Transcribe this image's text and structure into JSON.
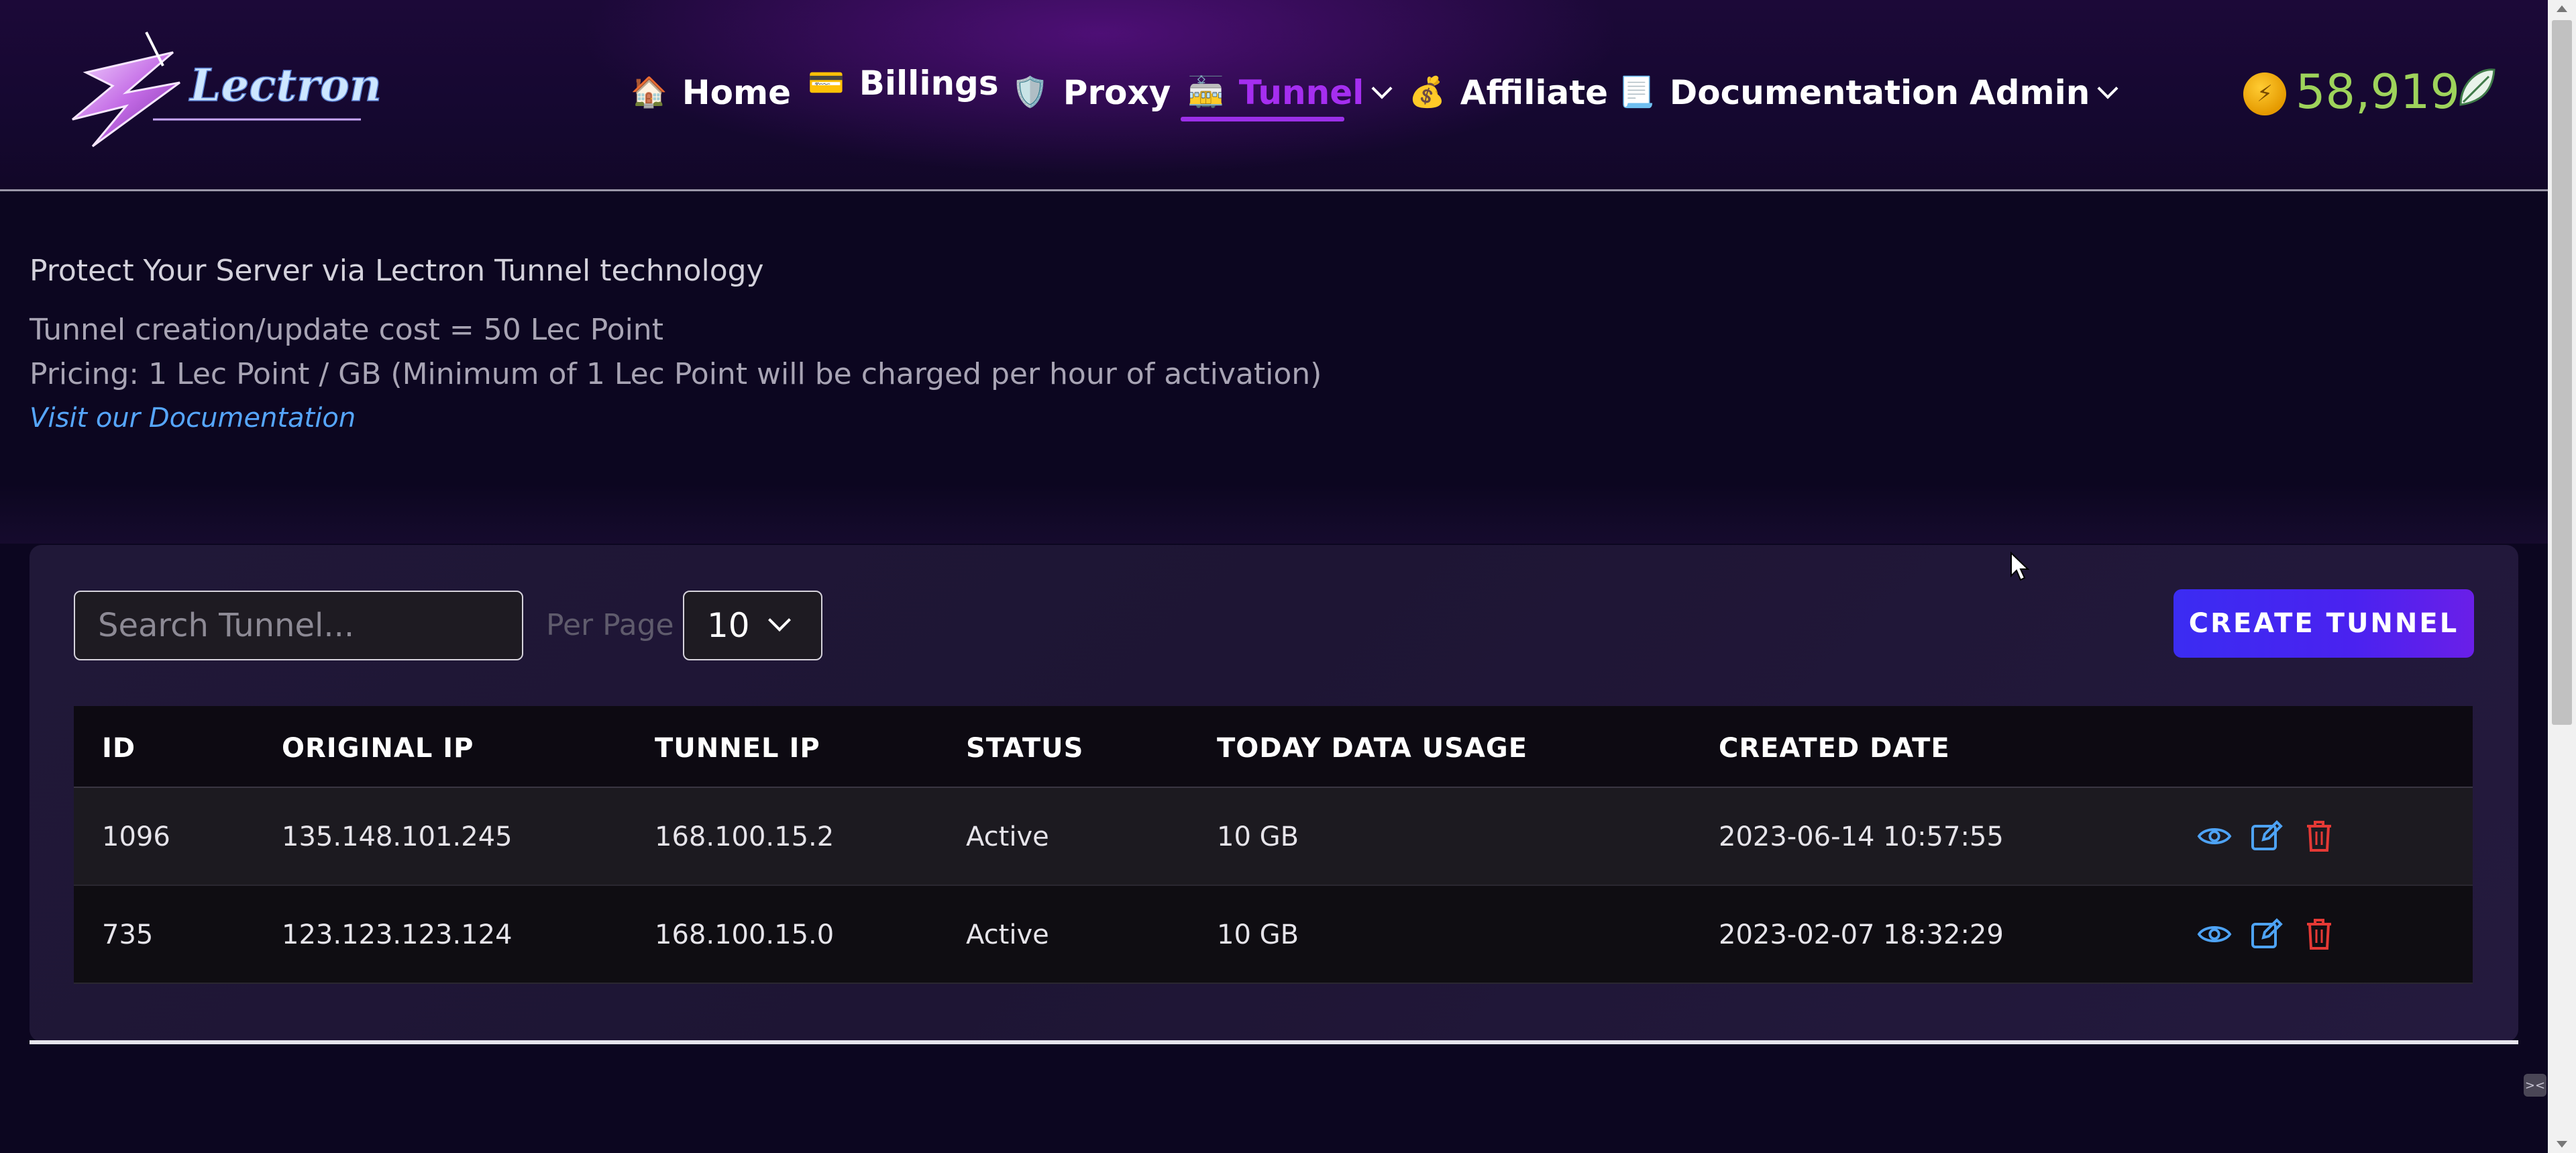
{
  "brand": {
    "logo_text": "Lectron"
  },
  "nav": {
    "items": [
      {
        "label": "Home",
        "icon": "🏠",
        "icon_name": "home-icon"
      },
      {
        "label": "Billings",
        "icon": "💳",
        "icon_name": "credit-card-icon"
      },
      {
        "label": "Proxy",
        "icon": "🛡️",
        "icon_name": "shield-icon"
      },
      {
        "label": "Tunnel",
        "icon": "🚋",
        "icon_name": "tram-icon",
        "active": true,
        "dropdown": true
      },
      {
        "label": "Affiliate",
        "icon": "💰",
        "icon_name": "money-bag-icon"
      },
      {
        "label": "Documentation",
        "icon": "📃",
        "icon_name": "document-icon"
      },
      {
        "label": "Admin",
        "dropdown": true
      }
    ],
    "balance": "58,919",
    "accent_color": "#a52ef0"
  },
  "intro": {
    "title": "Protect Your Server via Lectron Tunnel technology",
    "cost_line": "Tunnel creation/update cost = 50 Lec Point",
    "pricing_line": "Pricing: 1 Lec Point / GB (Minimum of 1 Lec Point will be charged per hour of activation)",
    "doc_link": "Visit our Documentation"
  },
  "toolbar": {
    "search_placeholder": "Search Tunnel...",
    "per_page_label": "Per Page",
    "per_page_value": "10",
    "create_button": "CREATE TUNNEL"
  },
  "table": {
    "headers": [
      "ID",
      "ORIGINAL IP",
      "TUNNEL IP",
      "STATUS",
      "TODAY DATA USAGE",
      "CREATED DATE"
    ],
    "rows": [
      {
        "id": "1096",
        "original_ip": "135.148.101.245",
        "tunnel_ip": "168.100.15.2",
        "status": "Active",
        "usage": "10 GB",
        "created": "2023-06-14 10:57:55"
      },
      {
        "id": "735",
        "original_ip": "123.123.123.124",
        "tunnel_ip": "168.100.15.0",
        "status": "Active",
        "usage": "10 GB",
        "created": "2023-02-07 18:32:29"
      }
    ],
    "action_icons": [
      "eye-icon",
      "edit-icon",
      "trash-icon"
    ]
  },
  "colors": {
    "view_icon": "#4ea3f5",
    "edit_icon": "#4ea3f5",
    "delete_icon": "#e53935",
    "balance": "#9ed35b"
  }
}
